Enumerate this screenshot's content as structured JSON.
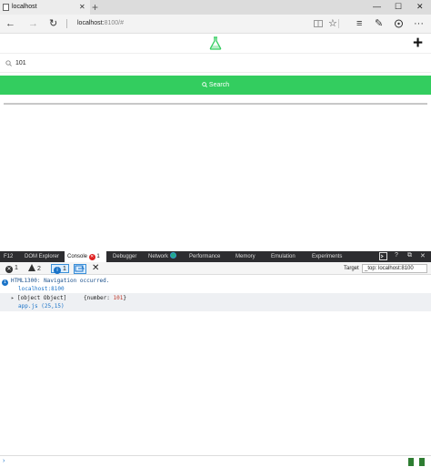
{
  "browser": {
    "tab_title": "localhost",
    "new_tab": "+",
    "window_controls": [
      "—",
      "☐",
      "✕"
    ],
    "url_host": "localhost:",
    "url_rest": "8100/#"
  },
  "app": {
    "logo_icon": "flask-icon",
    "add_label": "+",
    "search_value": "101",
    "search_button_label": "Search",
    "accent_color": "#33cd5f"
  },
  "devtools": {
    "tabs": [
      "F12",
      "DOM Explorer",
      "Console",
      "Debugger",
      "Network",
      "Performance",
      "Memory",
      "Emulation",
      "Experiments"
    ],
    "console_error_badge": "1",
    "filters": {
      "errors": "1",
      "warnings": "2",
      "messages": "1"
    },
    "target_label": "Target",
    "target_value": "_top: localhost:8100",
    "output": {
      "nav_message": "HTML1300: Navigation occurred.",
      "nav_source": "localhost:8100",
      "object_summary": "[object Object]",
      "object_key": "{number: ",
      "object_value": "101",
      "object_close": "}",
      "object_source": "app.js (25,15)"
    },
    "prompt": "›"
  }
}
